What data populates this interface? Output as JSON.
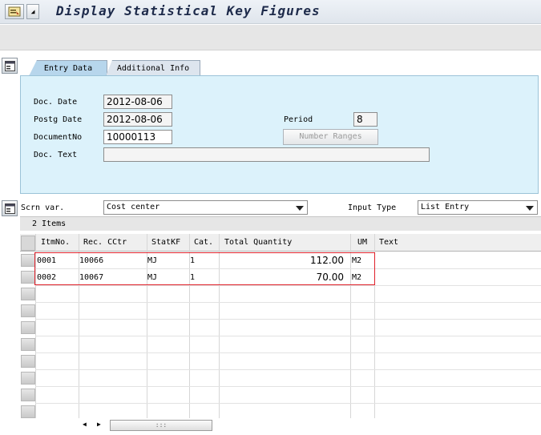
{
  "window": {
    "title": "Display Statistical Key Figures"
  },
  "tabs": [
    {
      "label": "Entry Data",
      "active": true
    },
    {
      "label": "Additional Info",
      "active": false
    }
  ],
  "entry": {
    "doc_date_label": "Doc. Date",
    "doc_date_value": "2012-08-06",
    "postg_date_label": "Postg Date",
    "postg_date_value": "2012-08-06",
    "document_no_label": "DocumentNo",
    "document_no_value": "10000113",
    "doc_text_label": "Doc. Text",
    "doc_text_value": "",
    "period_label": "Period",
    "period_value": "8",
    "number_ranges_label": "Number Ranges"
  },
  "selectors": {
    "screen_variant_label": "Scrn var.",
    "screen_variant_value": "Cost center",
    "input_type_label": "Input Type",
    "input_type_value": "List Entry"
  },
  "items": {
    "title": "2 Items",
    "columns": [
      "ItmNo.",
      "Rec. CCtr",
      "StatKF",
      "Cat.",
      "Total Quantity",
      "UM",
      "Text"
    ],
    "rows": [
      {
        "itm": "0001",
        "cctr": "10066",
        "statkf": "MJ",
        "cat": "1",
        "qty": "112.00",
        "um": "M2",
        "text": ""
      },
      {
        "itm": "0002",
        "cctr": "10067",
        "statkf": "MJ",
        "cat": "1",
        "qty": "70.00",
        "um": "M2",
        "text": ""
      }
    ],
    "scroll_thumb": ":::"
  },
  "colors": {
    "panel_bg": "#dcf2fb",
    "active_tab": "#b7d6ec",
    "highlight_border": "#e0202a"
  },
  "icons": {
    "menu": "menu-icon",
    "screen_toggle": "screen-layout-icon",
    "variant_toggle": "screen-layout-icon"
  }
}
